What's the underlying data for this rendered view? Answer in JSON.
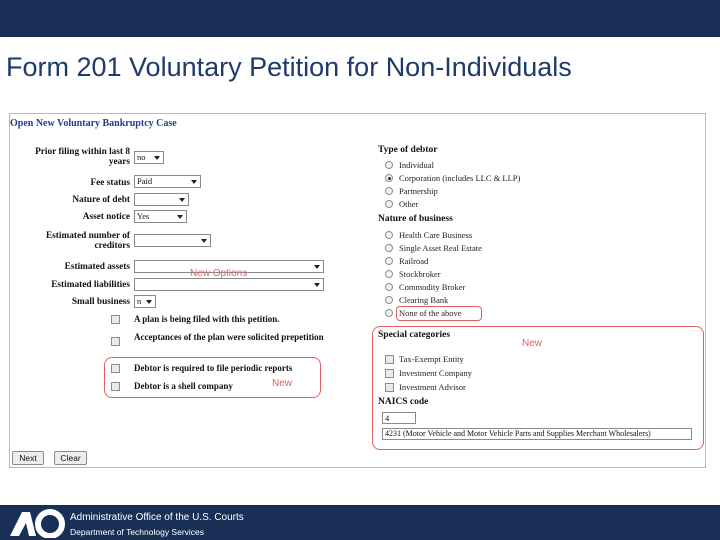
{
  "slide": {
    "title": "Form 201 Voluntary Petition for Non-Individuals"
  },
  "form": {
    "heading": "Open New Voluntary Bankruptcy Case",
    "fields": {
      "prior_filing": {
        "label": "Prior filing within last 8 years",
        "value": "no"
      },
      "fee_status": {
        "label": "Fee status",
        "value": "Paid"
      },
      "nature_of_debt": {
        "label": "Nature of debt",
        "value": ""
      },
      "asset_notice": {
        "label": "Asset notice",
        "value": "Yes"
      },
      "estimated_creditors": {
        "label": "Estimated number of creditors",
        "value": ""
      },
      "estimated_assets": {
        "label": "Estimated assets",
        "value": ""
      },
      "estimated_liabilities": {
        "label": "Estimated liabilities",
        "value": ""
      },
      "small_business": {
        "label": "Small business",
        "value": "n"
      }
    },
    "checkboxes": [
      {
        "label": "A plan is being filed with this petition.",
        "checked": false
      },
      {
        "label": "Acceptances of the plan were solicited prepetition",
        "checked": false
      },
      {
        "label": "Debtor is required to file periodic reports",
        "checked": false
      },
      {
        "label": "Debtor is a shell company",
        "checked": false
      }
    ],
    "type_of_debtor": {
      "title": "Type of debtor",
      "options": [
        "Individual",
        "Corporation (includes LLC & LLP)",
        "Partnership",
        "Other"
      ],
      "selected": "Corporation (includes LLC & LLP)"
    },
    "nature_of_business": {
      "title": "Nature of business",
      "options": [
        "Health Care Business",
        "Single Asset Real Estate",
        "Railroad",
        "Stockbroker",
        "Commodity Broker",
        "Clearing Bank",
        "None of the above"
      ],
      "selected": ""
    },
    "special_categories": {
      "title": "Special categories",
      "options": [
        "Tax-Exempt Entity",
        "Investment Company",
        "Investment Advisor"
      ]
    },
    "naics": {
      "title": "NAICS code",
      "code": "4",
      "description": "4231 (Motor Vehicle and Motor Vehicle Parts and Supplies Merchant Wholesalers)"
    },
    "buttons": {
      "next": "Next",
      "clear": "Clear"
    }
  },
  "annotations": {
    "new_options": "New Options",
    "new_periodic": "New",
    "new_special": "New"
  },
  "footer": {
    "line1": "Administrative Office of the U.S. Courts",
    "line2": "Department of Technology Services"
  },
  "colors": {
    "banner": "#1a2f56",
    "title": "#1f3a6b",
    "form_heading": "#1c3f94",
    "annotation": "#e06060"
  }
}
